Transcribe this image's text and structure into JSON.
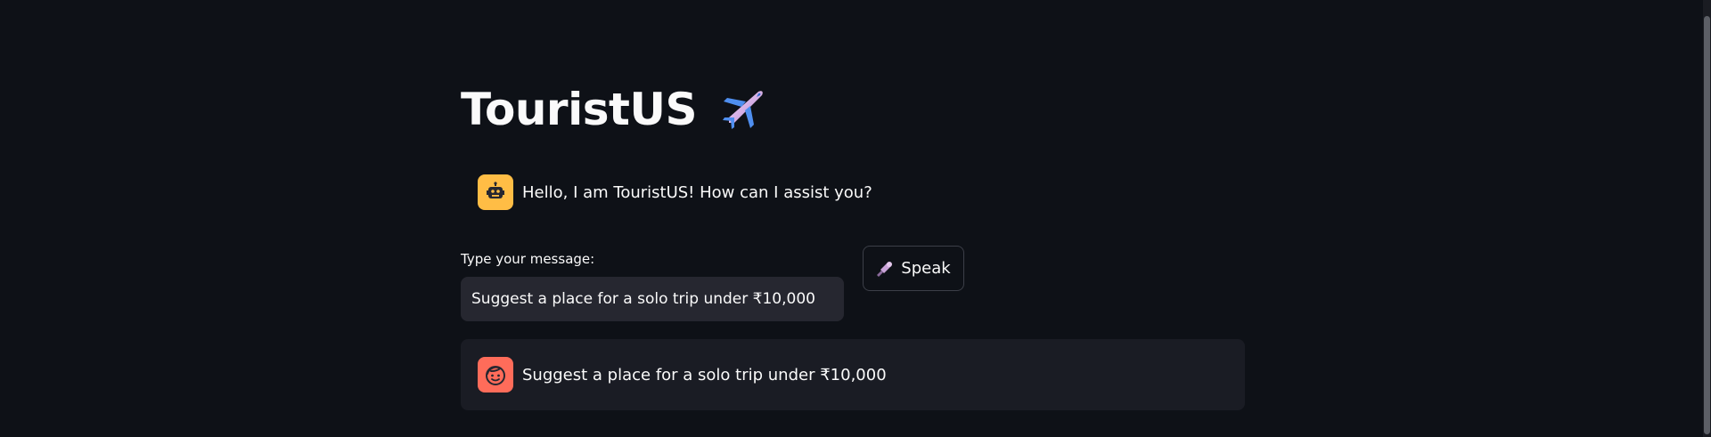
{
  "app": {
    "title": "TouristUS",
    "title_icon": "airplane-icon"
  },
  "chat": {
    "bot_message": {
      "avatar_icon": "robot-icon",
      "text": "Hello, I am TouristUS! How can I assist you?"
    },
    "user_message": {
      "avatar_icon": "user-face-icon",
      "text": "Suggest a place for a solo trip under ₹10,000"
    }
  },
  "input": {
    "label": "Type your message:",
    "value": "Suggest a place for a solo trip under ₹10,000"
  },
  "speak_button": {
    "icon": "microphone-icon",
    "label": "Speak"
  },
  "colors": {
    "background": "#0e1117",
    "bot_avatar": "#ffbd45",
    "user_avatar": "#ff6c5a",
    "input_bg": "#262730",
    "user_message_bg": "#1a1c24"
  }
}
